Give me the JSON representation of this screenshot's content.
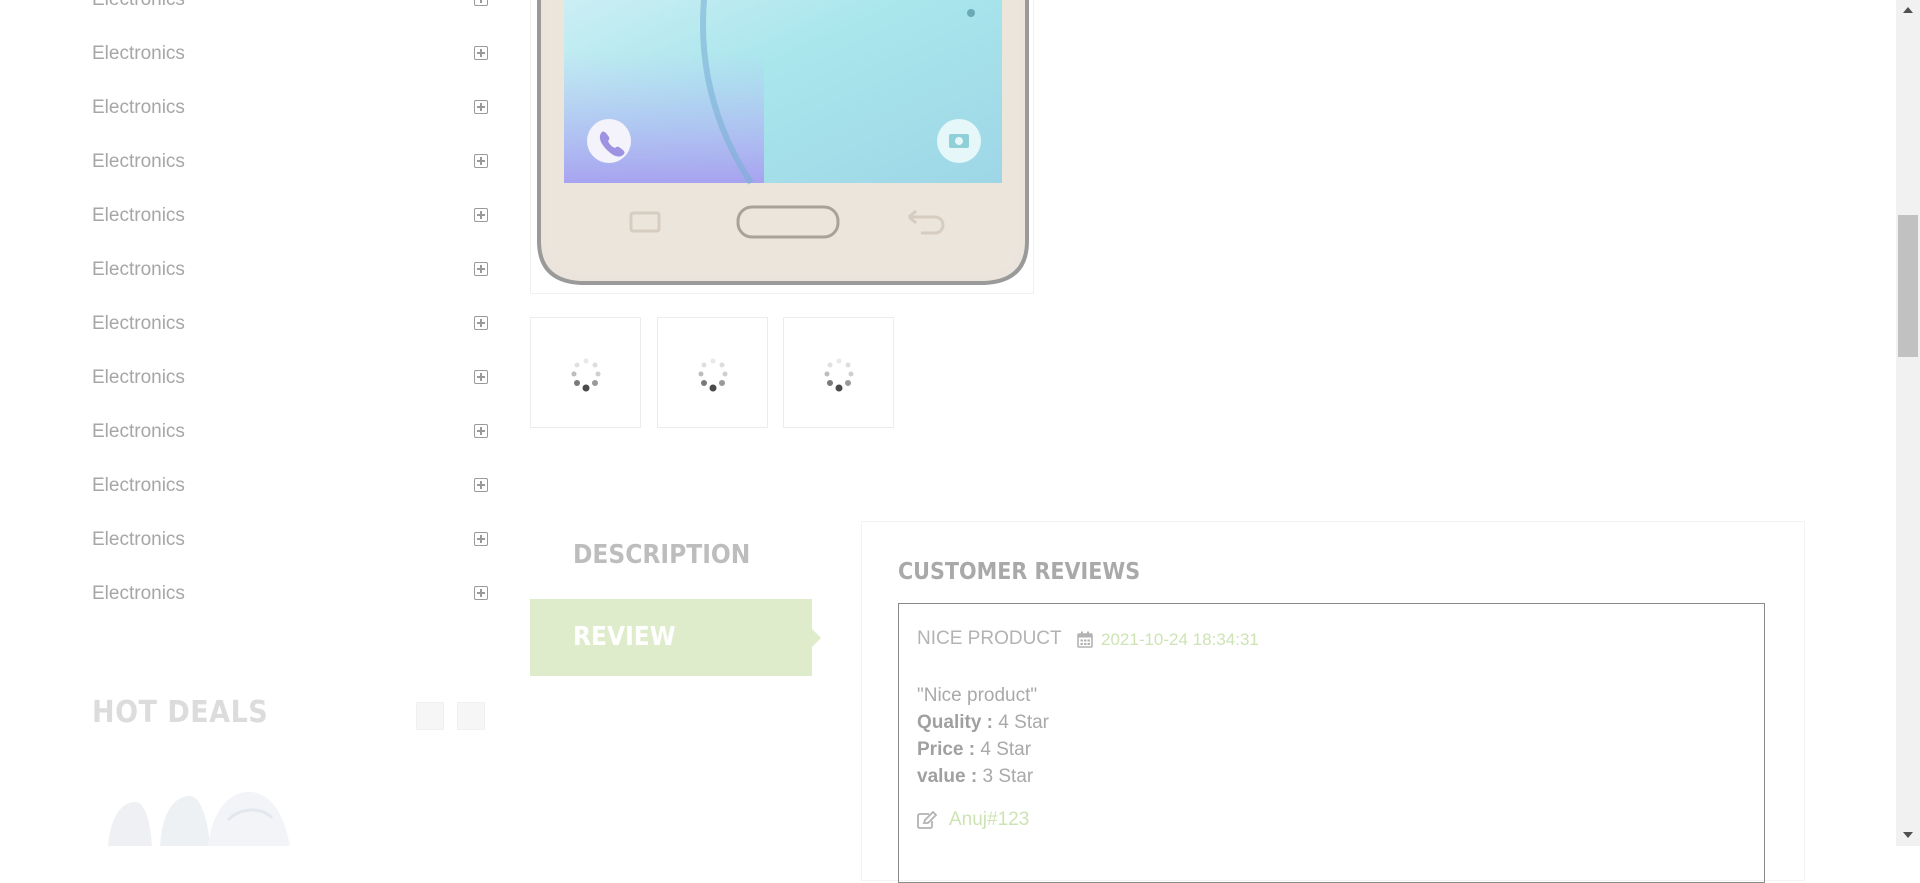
{
  "sidebar": {
    "categories": [
      {
        "label": "Electronics"
      },
      {
        "label": "Electronics"
      },
      {
        "label": "Electronics"
      },
      {
        "label": "Electronics"
      },
      {
        "label": "Electronics"
      },
      {
        "label": "Electronics"
      },
      {
        "label": "Electronics"
      },
      {
        "label": "Electronics"
      },
      {
        "label": "Electronics"
      },
      {
        "label": "Electronics"
      },
      {
        "label": "Electronics"
      },
      {
        "label": "Electronics"
      }
    ],
    "expand_icon": "plus-square-icon",
    "hot_deals": {
      "title": "HOT DEALS",
      "prev_icon": "chevron-left-icon",
      "next_icon": "chevron-right-icon"
    }
  },
  "product": {
    "main_image_icon": "smartphone-image",
    "thumbnails": [
      {
        "icon": "loading-spinner-icon"
      },
      {
        "icon": "loading-spinner-icon"
      },
      {
        "icon": "loading-spinner-icon"
      }
    ]
  },
  "tabs": {
    "description": "DESCRIPTION",
    "review": "REVIEW",
    "active": "review"
  },
  "reviews": {
    "title": "CUSTOMER REVIEWS",
    "items": [
      {
        "heading": "NICE PRODUCT",
        "date_icon": "calendar-icon",
        "date": "2021-10-24 18:34:31",
        "text": "\"Nice product\"",
        "quality_label": "Quality :",
        "quality_value": "4 Star",
        "price_label": "Price :",
        "price_value": "4 Star",
        "value_label": "value :",
        "value_value": "3 Star",
        "author_icon": "edit-icon",
        "author": "Anuj#123"
      }
    ]
  },
  "colors": {
    "accent_green": "#cde3b4",
    "active_tab_bg": "#dfeccc",
    "muted_text": "#a6a6a6"
  }
}
